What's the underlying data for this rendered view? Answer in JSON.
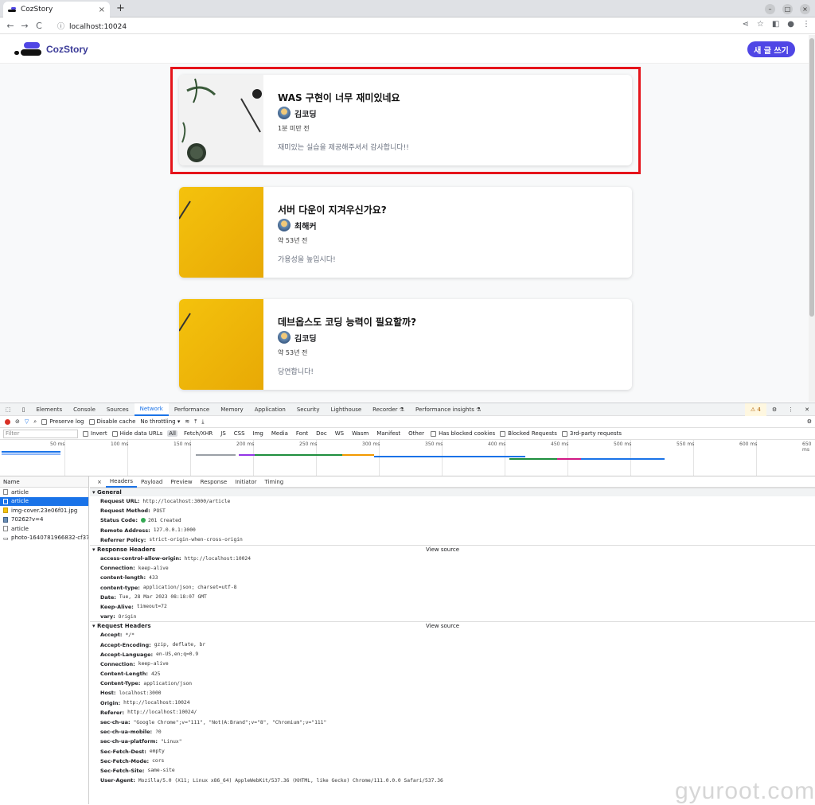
{
  "browser": {
    "tab_title": "CozStory",
    "tab_close": "×",
    "new_tab": "+",
    "url": "localhost:10024",
    "nav": {
      "back": "←",
      "forward": "→",
      "reload": "C"
    },
    "window_controls": {
      "minimize": "–",
      "maximize": "□",
      "close": "×"
    }
  },
  "app": {
    "brand": "CozStory",
    "write_button": "새 글 쓰기",
    "brand_color": "#4f46e5"
  },
  "articles": [
    {
      "title": "WAS 구현이 너무 재미있네요",
      "author": "김코딩",
      "time": "1분 미만 전",
      "body": "재미있는 실습을 제공해주셔서 감사합니다!!",
      "thumb": "white"
    },
    {
      "title": "서버 다운이 지겨우신가요?",
      "author": "최해커",
      "time": "약 53년 전",
      "body": "가용성을 높입시다!",
      "thumb": "yellow"
    },
    {
      "title": "데브옵스도 코딩 능력이 필요할까?",
      "author": "김코딩",
      "time": "약 53년 전",
      "body": "당연합니다!",
      "thumb": "yellow"
    }
  ],
  "devtools": {
    "panels": [
      "Elements",
      "Console",
      "Sources",
      "Network",
      "Performance",
      "Memory",
      "Application",
      "Security",
      "Lighthouse",
      "Recorder ⚗",
      "Performance insights ⚗"
    ],
    "warning_count": "⚠ 4",
    "toolbar": {
      "preserve_log": "Preserve log",
      "disable_cache": "Disable cache",
      "throttling": "No throttling"
    },
    "filter": {
      "placeholder": "Filter",
      "invert": "Invert",
      "hide_data_urls": "Hide data URLs",
      "types": [
        "All",
        "Fetch/XHR",
        "JS",
        "CSS",
        "Img",
        "Media",
        "Font",
        "Doc",
        "WS",
        "Wasm",
        "Manifest",
        "Other"
      ],
      "has_blocked_cookies": "Has blocked cookies",
      "blocked_requests": "Blocked Requests",
      "third_party": "3rd-party requests"
    },
    "timeline_ticks": [
      "50 ms",
      "100 ms",
      "150 ms",
      "200 ms",
      "250 ms",
      "300 ms",
      "350 ms",
      "400 ms",
      "450 ms",
      "500 ms",
      "550 ms",
      "600 ms",
      "650 ms"
    ],
    "name_header": "Name",
    "requests": [
      {
        "name": "article",
        "selected": false
      },
      {
        "name": "article",
        "selected": true
      },
      {
        "name": "img-cover.23e06f01.jpg",
        "selected": false
      },
      {
        "name": "70262?v=4",
        "selected": false
      },
      {
        "name": "article",
        "selected": false
      },
      {
        "name": "photo-1640781966832-cf37...",
        "selected": false
      }
    ],
    "detail_close": "×",
    "detail_tabs": [
      "Headers",
      "Payload",
      "Preview",
      "Response",
      "Initiator",
      "Timing"
    ],
    "general": {
      "title": "▾ General",
      "rows": [
        {
          "k": "Request URL:",
          "v": "http://localhost:3000/article"
        },
        {
          "k": "Request Method:",
          "v": "POST"
        },
        {
          "k": "Status Code:",
          "v": "201 Created"
        },
        {
          "k": "Remote Address:",
          "v": "127.0.0.1:3000"
        },
        {
          "k": "Referrer Policy:",
          "v": "strict-origin-when-cross-origin"
        }
      ]
    },
    "response_headers": {
      "title": "▾ Response Headers",
      "view_source": "View source",
      "rows": [
        {
          "k": "access-control-allow-origin:",
          "v": "http://localhost:10024"
        },
        {
          "k": "Connection:",
          "v": "keep-alive"
        },
        {
          "k": "content-length:",
          "v": "433"
        },
        {
          "k": "content-type:",
          "v": "application/json; charset=utf-8"
        },
        {
          "k": "Date:",
          "v": "Tue, 28 Mar 2023 08:18:07 GMT"
        },
        {
          "k": "Keep-Alive:",
          "v": "timeout=72"
        },
        {
          "k": "vary:",
          "v": "Origin"
        }
      ]
    },
    "request_headers": {
      "title": "▾ Request Headers",
      "view_source": "View source",
      "rows": [
        {
          "k": "Accept:",
          "v": "*/*"
        },
        {
          "k": "Accept-Encoding:",
          "v": "gzip, deflate, br"
        },
        {
          "k": "Accept-Language:",
          "v": "en-US,en;q=0.9"
        },
        {
          "k": "Connection:",
          "v": "keep-alive"
        },
        {
          "k": "Content-Length:",
          "v": "425"
        },
        {
          "k": "Content-Type:",
          "v": "application/json"
        },
        {
          "k": "Host:",
          "v": "localhost:3000"
        },
        {
          "k": "Origin:",
          "v": "http://localhost:10024"
        },
        {
          "k": "Referer:",
          "v": "http://localhost:10024/"
        },
        {
          "k": "sec-ch-ua:",
          "v": "\"Google Chrome\";v=\"111\", \"Not(A:Brand\";v=\"8\", \"Chromium\";v=\"111\""
        },
        {
          "k": "sec-ch-ua-mobile:",
          "v": "?0"
        },
        {
          "k": "sec-ch-ua-platform:",
          "v": "\"Linux\""
        },
        {
          "k": "Sec-Fetch-Dest:",
          "v": "empty"
        },
        {
          "k": "Sec-Fetch-Mode:",
          "v": "cors"
        },
        {
          "k": "Sec-Fetch-Site:",
          "v": "same-site"
        },
        {
          "k": "User-Agent:",
          "v": "Mozilla/5.0 (X11; Linux x86_64) AppleWebKit/537.36 (KHTML, like Gecko) Chrome/111.0.0.0 Safari/537.36"
        }
      ]
    }
  },
  "watermark": "gyuroot.com",
  "colors": {
    "highlight": "#e5141b",
    "devtools_accent": "#1a73e8"
  }
}
